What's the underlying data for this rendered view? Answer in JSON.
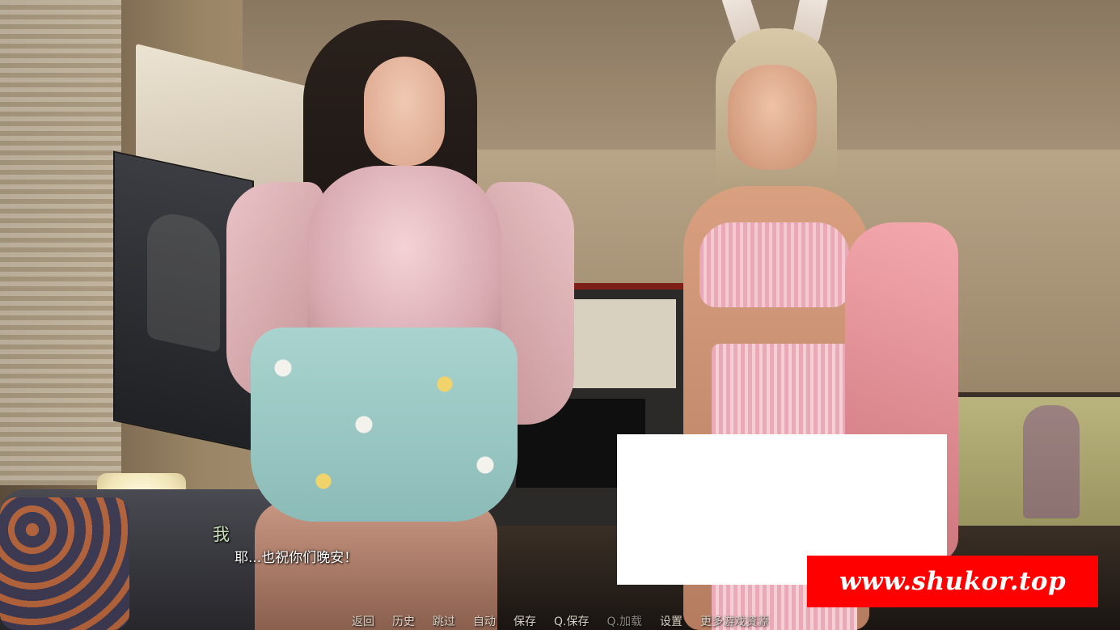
{
  "dialogue": {
    "speaker": "我",
    "text": "耶...也祝你们晚安！"
  },
  "quick_menu": [
    {
      "label": "返回",
      "enabled": true
    },
    {
      "label": "历史",
      "enabled": true
    },
    {
      "label": "跳过",
      "enabled": true
    },
    {
      "label": "自动",
      "enabled": true
    },
    {
      "label": "保存",
      "enabled": true
    },
    {
      "label": "Q.保存",
      "enabled": true
    },
    {
      "label": "Q.加载",
      "enabled": false
    },
    {
      "label": "设置",
      "enabled": true
    },
    {
      "label": "更多游戏资源",
      "enabled": true
    }
  ],
  "watermark": {
    "text": "www.shukor.top"
  },
  "colors": {
    "speaker_name": "#c9e0b8",
    "dialogue_text": "#ffffff",
    "menu_text": "#d8d0c4",
    "menu_disabled": "#8a8580",
    "watermark_bg": "#ff0000"
  }
}
